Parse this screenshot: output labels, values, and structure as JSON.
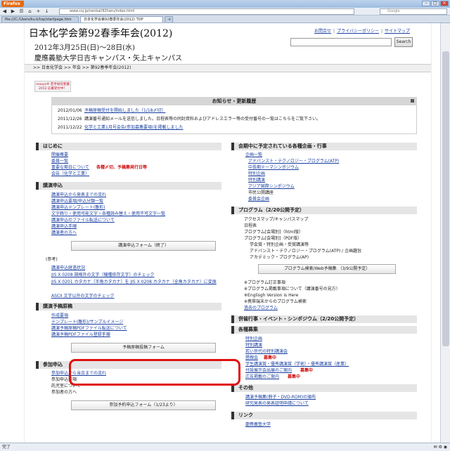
{
  "browser": {
    "menu_label": "Firefox",
    "url": "www.csj.jp/nenkai/92haru/index.html",
    "search_placeholder": "Google",
    "tabs": [
      {
        "label": "file:///C:/Users/ku.k/top/startpage.htm"
      },
      {
        "label": "日本化学会第92春季年会(2012) TOP"
      }
    ],
    "status_left": "完了"
  },
  "header": {
    "title": "日本化学会第92春季年会(2012)",
    "date": "2012年3月25日(日)～28日(水)",
    "venue": "慶應義塾大学日吉キャンパス・矢上キャンパス",
    "links": [
      "お問合せ",
      "プライバシーポリシー",
      "サイトマップ"
    ],
    "search_button": "Search"
  },
  "breadcrumb": ">> 日本化学会 >> 年会 >> 第92春季年会(2012)",
  "reaxys": "reaxys® 若手研究者賞 2012 応募受付中！",
  "news": {
    "heading": "お知らせ・更新履歴",
    "items": [
      {
        "date": "2012/01/06",
        "text": "予稿原稿受付を開始しました（1/18〆切）"
      },
      {
        "date": "2011/12/26",
        "text": "講演番号通知メールを送信しました。日程表等の同封資料およびアドレスエラー等の受付番号の一覧はこちらをご覧下さい。"
      },
      {
        "date": "2011/12/22",
        "text": "化学と工業1月号会告(参加募集要項)を掲載しました"
      }
    ]
  },
  "left": {
    "hajimeni": {
      "heading": "はじめに",
      "items": [
        "開催概要",
        "委員一覧",
        "重要な期日について",
        "会告（化学と工業）"
      ],
      "note": "各種〆切、予稿集発行日等"
    },
    "koen": {
      "heading": "講演申込",
      "items": [
        "講演申込から発表までの流れ",
        "講演申込要項/申込分類一覧",
        "講演申込テンプレート(雛形)",
        "文字飾り・使用可能文字・各種読み替え・使用不可文字一覧",
        "講演申込のファイル転送について",
        "講演申込手順",
        "講演者の方へ"
      ],
      "button": "講演申込フォーム（終了）",
      "ref_label": "(参考)",
      "ref_items": [
        "講演申込経過状況",
        "JIS X 0208 規格外の文字（機種依存文字）のチェック",
        "JIS X 0201 カタカナ（半角カタカナ）を JIS X 0208 カタカナ（全角カタカナ）に変換",
        "ASCII 文字以外の文字のチェック"
      ]
    },
    "yokou": {
      "heading": "講演予稿原稿",
      "items": [
        "作成要項",
        "テンプレート(雛形)/サンプルイメージ",
        "講演予稿原稿PDFファイル転送について",
        "講演予稿PDFファイル登録手順"
      ],
      "button": "予稿原稿投稿フォーム"
    },
    "sanka": {
      "heading": "参加申込",
      "items": [
        "参加申込から当日までの流れ",
        "参加申込要項",
        "託児室について",
        "参加者の方へ"
      ],
      "button": "参加予約申込フォーム（1/23より）"
    }
  },
  "right": {
    "kikaku": {
      "heading": "会期中に予定されている各種企画・行事",
      "items": [
        "企画一覧",
        "アドバンスト・テクノロジー・プログラム(ATP)",
        "中長期テーマシンポジウム",
        "特別企画",
        "特別講演",
        "アジア国際シンポジウム",
        "市民公開講座",
        "委員会企画"
      ]
    },
    "program": {
      "heading": "プログラム（2/20公開予定）",
      "items": [
        "アクセスマップ/キャンパスマップ",
        "日程表",
        "プログラム[会場別]（html版）",
        "プログラム[会場別]（PDF版）",
        "学会賞・特別企画・受賞講演等",
        "アドバンスト・テクノロジー・プログラム(ATP) / 企画趣旨",
        "アカデミック・プログラム(AP)"
      ],
      "button": "プログラム検索/Web予稿集 （3/9公開予定）",
      "notes": [
        "※プログラム訂正事項",
        "※プログラム掲載事項について（講演番号の見方）",
        "※Englisgh Version is Here",
        "※携帯端末からのプログラム検索",
        "過去のプログラム"
      ]
    },
    "heisai": {
      "heading": "併催行事・イベント・シンポジウム（2/20公開予定）"
    },
    "boshu": {
      "heading": "各種募集",
      "items": [
        "特別企画",
        "特別講演",
        "若い世代の特別講演会",
        "懇親会",
        "学生講演賞・優秀講演賞（学術）・優秀講演賞（産業）",
        "付設展示会出展のご案内",
        "広告掲載のご案内"
      ],
      "badge": "募集中"
    },
    "sonota": {
      "heading": "その他",
      "items": [
        "講演予稿集(冊子・DVD-ROM)の頒布",
        "研究発表の発表証明申請について"
      ]
    },
    "link": {
      "heading": "リンク",
      "items": [
        "慶應義塾大学"
      ]
    }
  }
}
